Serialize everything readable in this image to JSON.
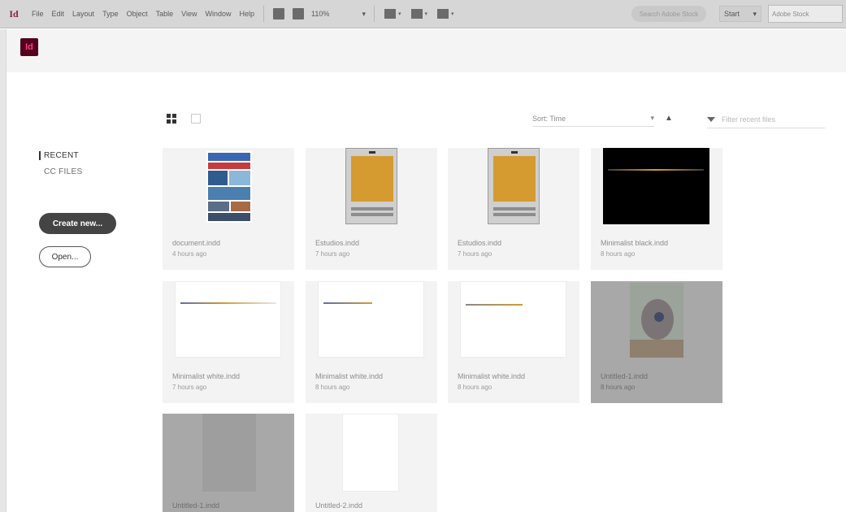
{
  "menubar": {
    "app_glyph": "Id",
    "menus": [
      "File",
      "Edit",
      "Layout",
      "Type",
      "Object",
      "Table",
      "View",
      "Window",
      "Help"
    ],
    "zoom": "110%",
    "search_cc": "Search Adobe Stock",
    "workspace": "Start",
    "help_search": "Adobe Stock"
  },
  "header": {
    "logo": "Id"
  },
  "sidebar": {
    "items": [
      {
        "label": "RECENT",
        "active": true
      },
      {
        "label": "CC FILES",
        "active": false
      }
    ],
    "create_label": "Create new...",
    "open_label": "Open..."
  },
  "toolbar": {
    "sort_label": "Sort: Time",
    "sort_caret": "▾",
    "sort_dir": "▲",
    "filter_placeholder": "Filter recent files"
  },
  "files": [
    {
      "name": "document.indd",
      "time": "4 hours ago"
    },
    {
      "name": "Estudios.indd",
      "time": "7 hours ago"
    },
    {
      "name": "Estudios.indd",
      "time": "7 hours ago"
    },
    {
      "name": "Minimalist black.indd",
      "time": "8 hours ago"
    },
    {
      "name": "Minimalist white.indd",
      "time": "7 hours ago"
    },
    {
      "name": "Minimalist white.indd",
      "time": "8 hours ago"
    },
    {
      "name": "Minimalist white.indd",
      "time": "8 hours ago"
    },
    {
      "name": "Untitled-1.indd",
      "time": "8 hours ago"
    },
    {
      "name": "Untitled-1.indd",
      "time": ""
    },
    {
      "name": "Untitled-2.indd",
      "time": ""
    }
  ],
  "colors": {
    "accent": "#d59b31",
    "indesign_logo_bg": "#54021b",
    "indesign_logo_fg": "#ff3d8b"
  }
}
